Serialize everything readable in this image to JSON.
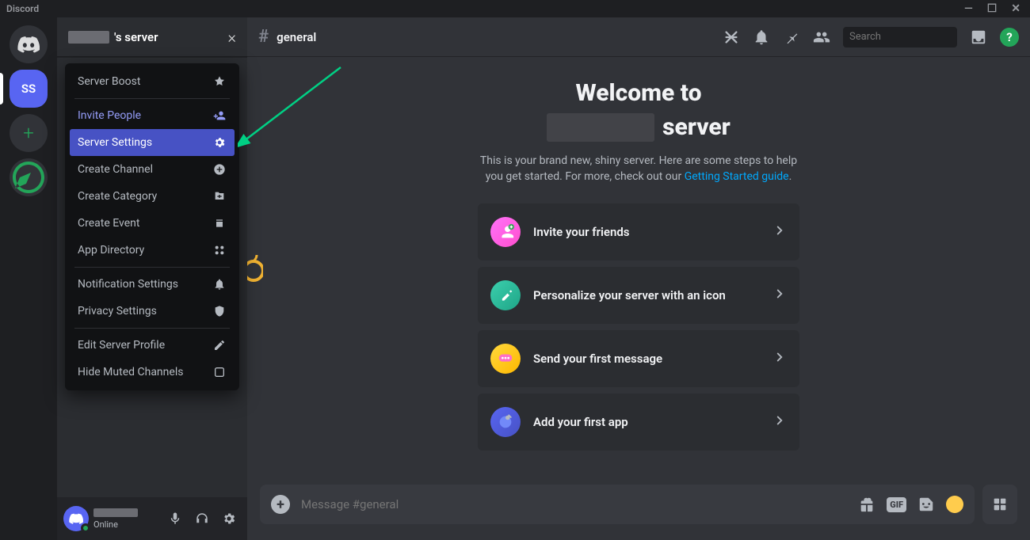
{
  "app_name": "Discord",
  "server_rail": {
    "selected_server_abbr": "SS"
  },
  "server_header": {
    "suffix": "'s server"
  },
  "dropdown": {
    "server_boost": "Server Boost",
    "invite_people": "Invite People",
    "server_settings": "Server Settings",
    "create_channel": "Create Channel",
    "create_category": "Create Category",
    "create_event": "Create Event",
    "app_directory": "App Directory",
    "notification_settings": "Notification Settings",
    "privacy_settings": "Privacy Settings",
    "edit_server_profile": "Edit Server Profile",
    "hide_muted": "Hide Muted Channels"
  },
  "user_panel": {
    "status": "Online"
  },
  "channel_header": {
    "name": "general",
    "search_placeholder": "Search"
  },
  "welcome": {
    "line1": "Welcome to",
    "line2_suffix": " server",
    "subtitle_a": "This is your brand new, shiny server. Here are some steps to help you get started. For more, check out our ",
    "subtitle_link": "Getting Started guide",
    "cards": {
      "invite": "Invite your friends",
      "personalize": "Personalize your server with an icon",
      "first_message": "Send your first message",
      "first_app": "Add your first app"
    }
  },
  "composer": {
    "placeholder": "Message #general"
  },
  "help_char": "?"
}
